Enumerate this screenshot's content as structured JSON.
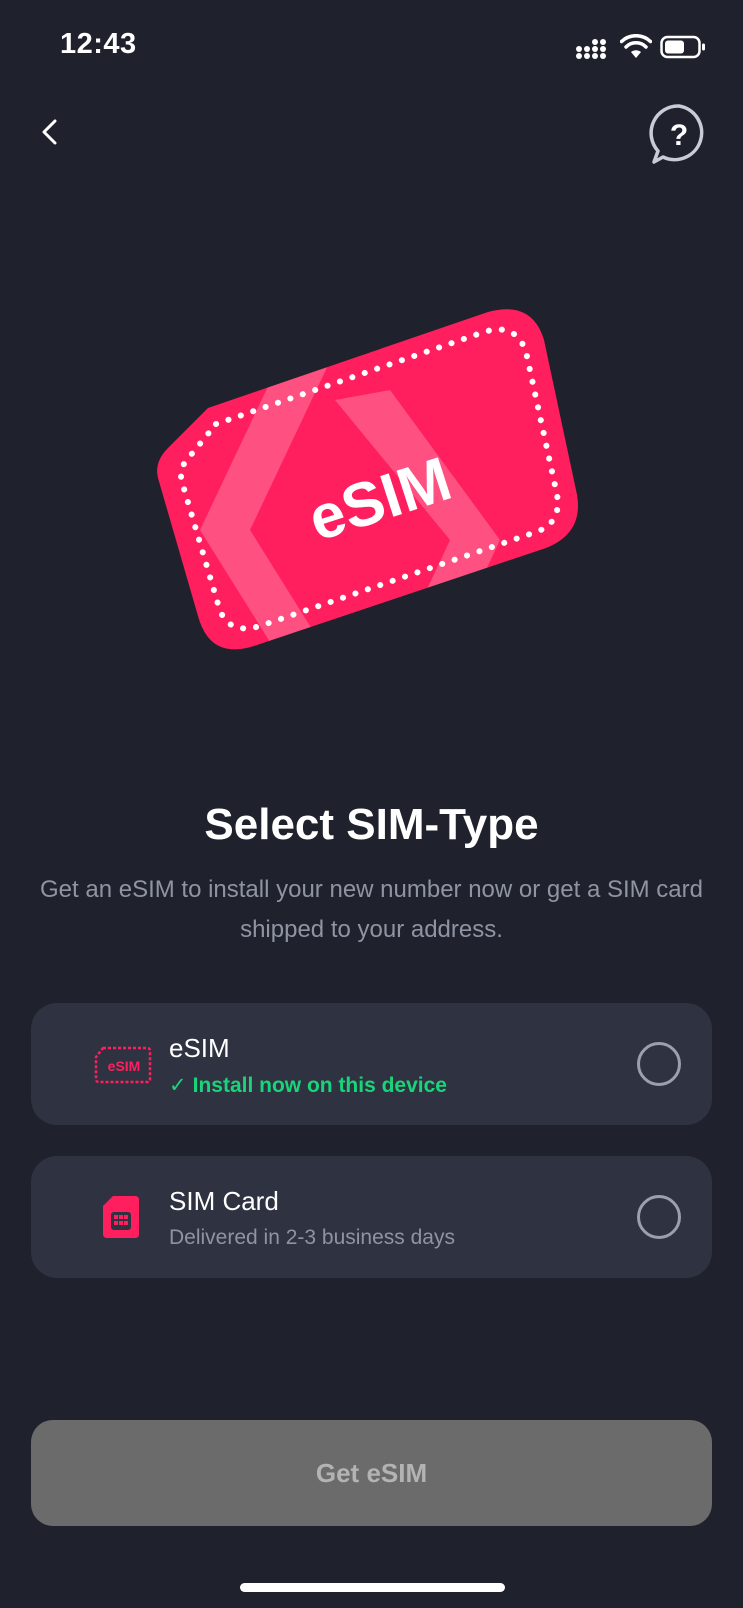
{
  "status_bar": {
    "time": "12:43",
    "icons": [
      "signal-icon",
      "wifi-icon",
      "battery-icon"
    ]
  },
  "nav": {
    "back_icon": "chevron-left-icon",
    "help_icon": "question-bubble-icon",
    "help_glyph": "?"
  },
  "hero": {
    "card_label": "eSIM",
    "card_color": "#ff1f5f"
  },
  "title": "Select SIM-Type",
  "subtitle": "Get an eSIM to install your new number now or get a SIM card shipped to your address.",
  "options": [
    {
      "icon": "esim-chip-icon",
      "icon_label": "eSIM",
      "title": "eSIM",
      "subtitle_check": "✓",
      "subtitle": "Install now on this device",
      "selected": false
    },
    {
      "icon": "sim-card-icon",
      "title": "SIM Card",
      "subtitle": "Delivered in 2-3 business days",
      "selected": false
    }
  ],
  "primary_button": {
    "label": "Get eSIM",
    "enabled": false
  },
  "colors": {
    "background": "#1f222c",
    "card_background": "#2f3240",
    "accent_pink": "#ff1f5f",
    "success_green": "#19d47a",
    "muted_text": "#8f94a3",
    "disabled_button": "#6b6b6b"
  }
}
